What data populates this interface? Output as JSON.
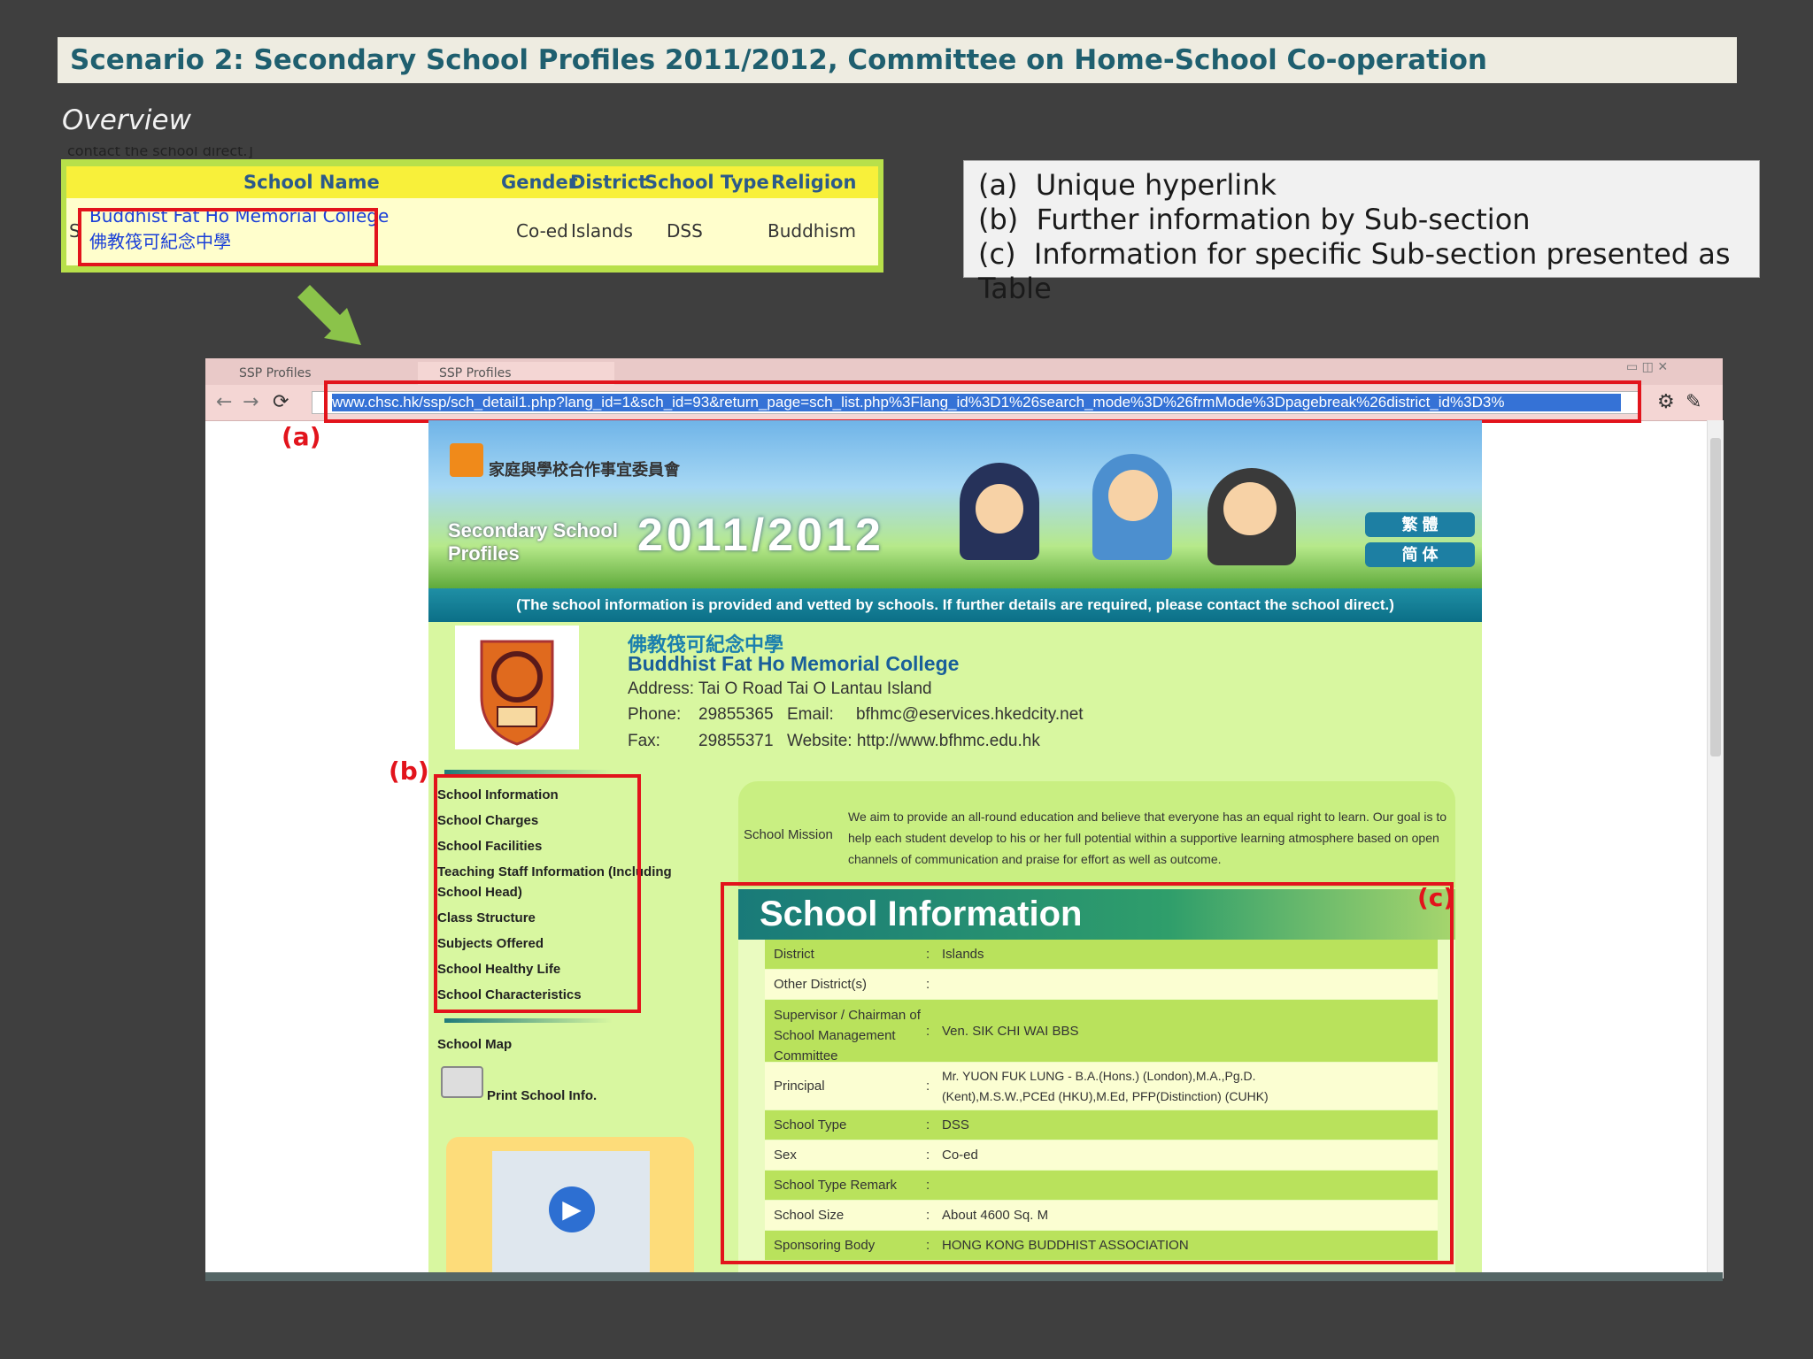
{
  "slide": {
    "title": "Scenario 2: Secondary School Profiles 2011/2012, Committee on Home-School Co-operation",
    "subtitle": "Overview"
  },
  "mini_table": {
    "cut_text": "contact the school direct.]",
    "headers": [
      "School Name",
      "Gender",
      "District",
      "School Type",
      "Religion"
    ],
    "row_prefix": "S",
    "row": {
      "name_en": "Buddhist Fat Ho Memorial College",
      "name_cn": "佛教筏可紀念中學",
      "gender": "Co-ed",
      "district": "Islands",
      "school_type": "DSS",
      "religion": "Buddhism"
    }
  },
  "legend": [
    {
      "key": "(a)",
      "text": "Unique hyperlink"
    },
    {
      "key": "(b)",
      "text": "Further information by Sub-section"
    },
    {
      "key": "(c)",
      "text": "Information for specific Sub-section presented as Table"
    }
  ],
  "markers": {
    "a": "(a)",
    "b": "(b)",
    "c": "(c)"
  },
  "browser": {
    "tabs": [
      "SSP Profiles",
      "SSP Profiles"
    ],
    "url": "www.chsc.hk/ssp/sch_detail1.php?lang_id=1&sch_id=93&return_page=sch_list.php%3Flang_id%3D1%26search_mode%3D%26frmMode%3Dpagebreak%26district_id%3D3%"
  },
  "page": {
    "banner": {
      "org_cn": "家庭與學校合作事宜委員會",
      "title_line1": "Secondary School",
      "title_line2": "Profiles",
      "year": "2011/2012",
      "lang_trad": "繁 體",
      "lang_simp": "简 体",
      "notice": "(The school information is provided and vetted by schools. If further details are required, please contact the school direct.)"
    },
    "school": {
      "name_cn": "佛教筏可紀念中學",
      "name_en": "Buddhist Fat Ho Memorial College",
      "address": "Address: Tai O Road Tai O Lantau Island",
      "phone_label": "Phone:",
      "phone": "29855365",
      "email_label": "Email:",
      "email": "bfhmc@eservices.hkedcity.net",
      "fax_label": "Fax:",
      "fax": "29855371",
      "website": "Website: http://www.bfhmc.edu.hk"
    },
    "sidebar": [
      "School Information",
      "School Charges",
      "School Facilities",
      "Teaching Staff Information (Including",
      "School Head)",
      "Class Structure",
      "Subjects Offered",
      "School Healthy Life",
      "School Characteristics"
    ],
    "school_map": "School Map",
    "print_info": "Print School Info.",
    "mission_label": "School Mission",
    "mission_text": "We aim to provide an all-round education and believe that everyone has an equal right to learn. Our goal is to help each student develop to his or her full potential within a supportive learning atmosphere based on open channels of communication and praise for effort as well as outcome.",
    "info_title": "School Information",
    "info_rows": [
      {
        "label": "District",
        "value": "Islands"
      },
      {
        "label": "Other District(s)",
        "value": ""
      },
      {
        "label": "Supervisor / Chairman of School Management Committee",
        "value": "Ven. SIK CHI WAI BBS"
      },
      {
        "label": "Principal",
        "value": "Mr. YUON FUK LUNG - B.A.(Hons.) (London),M.A.,Pg.D.(Kent),M.S.W.,PCEd (HKU),M.Ed, PFP(Distinction) (CUHK)"
      },
      {
        "label": "School Type",
        "value": "DSS"
      },
      {
        "label": "Sex",
        "value": "Co-ed"
      },
      {
        "label": "School Type Remark",
        "value": ""
      },
      {
        "label": "School Size",
        "value": "About 4600 Sq. M"
      },
      {
        "label": "Sponsoring Body",
        "value": "HONG KONG BUDDHIST ASSOCIATION"
      }
    ]
  }
}
